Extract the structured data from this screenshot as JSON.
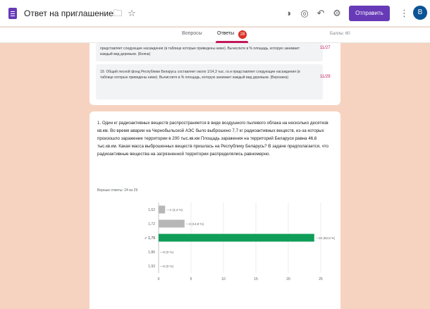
{
  "header": {
    "doc_title": "Ответ на приглашение",
    "send_label": "Отправить",
    "avatar_letter": "В",
    "icons": [
      "folder-icon",
      "star-icon",
      "palette-icon",
      "preview-icon",
      "undo-icon",
      "settings-icon",
      "more-vert-icon"
    ]
  },
  "tabs": {
    "questions": "Вопросы",
    "responses": "Ответы",
    "responses_badge": "28",
    "points": "Баллы: 60"
  },
  "answers": [
    {
      "text": "представляет следующие насаждения (в таблице которые приведены ниже). Вычислите в % площадь, которую занимает каждый вид деревьев. (Бояна)",
      "score": "11/27"
    },
    {
      "text": "19. Общий лесной фонд Республики Беларусь составляет около 1/14,3 тыс. га и представляет следующие насаждения (в таблице которые приведены ниже). Вычислите в % площадь, которую занимает каждый вид деревьев. (Вероника)",
      "score": "11/29"
    }
  ],
  "question": {
    "text": "1. Один кг радиоактивных веществ распространяется в виде воздушного пылевого облака на несколько десятков кв.км. Во время аварии на Чернобыльской АЭС было выброшено 7,7 кг радиоактивных веществ, из-за которых произошло заражение территории в 200 тыс.кв.км Площадь заражения на территорий Беларуси равна 46,6 тыс.кв.км. Какая масса выброшенных веществ пришлась на Республику Беларусь? В задаче предполагается, что радиоактивные вещества на загрязненной территории распределялись равномерно.",
    "count": "Верные ответы: 24 из 29"
  },
  "chart_data": {
    "type": "bar",
    "orientation": "horizontal",
    "categories": [
      "1,62",
      "1,72",
      "1,79",
      "1,86",
      "1,93"
    ],
    "correct_category": "1,79",
    "values": [
      1,
      4,
      24,
      0,
      0
    ],
    "value_labels": [
      "1 (3,4 %)",
      "4 (13,8 %)",
      "24 (82,8 %)",
      "0 (0 %)",
      "0 (0 %)"
    ],
    "x_ticks": [
      "0",
      "5",
      "10",
      "15",
      "20",
      "25"
    ],
    "xlim": [
      0,
      25
    ],
    "colors": {
      "correct": "#0f9d58",
      "other": "#b7b7b7",
      "axis": "#bdbdbd",
      "label": "#5f6368"
    }
  }
}
